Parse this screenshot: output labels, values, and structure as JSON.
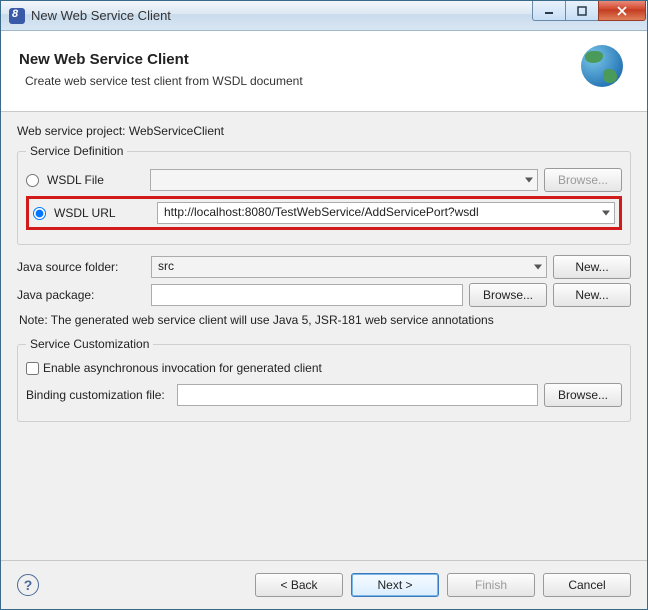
{
  "window": {
    "title": "New Web Service Client"
  },
  "banner": {
    "heading": "New Web Service Client",
    "subtitle": "Create web service test client from WSDL document"
  },
  "project": {
    "label": "Web service project:",
    "value": "WebServiceClient"
  },
  "service_definition": {
    "legend": "Service Definition",
    "wsdl_file": {
      "label": "WSDL File",
      "value": "",
      "browse": "Browse..."
    },
    "wsdl_url": {
      "label": "WSDL URL",
      "value": "http://localhost:8080/TestWebService/AddServicePort?wsdl",
      "selected": true
    }
  },
  "java_source": {
    "label": "Java source folder:",
    "value": "src",
    "new_btn": "New..."
  },
  "java_package": {
    "label": "Java package:",
    "value": "",
    "browse_btn": "Browse...",
    "new_btn": "New..."
  },
  "note": "Note: The generated web service client will use Java 5, JSR-181 web service annotations",
  "customization": {
    "legend": "Service Customization",
    "async_label": "Enable asynchronous invocation for generated client",
    "binding_label": "Binding customization file:",
    "binding_value": "",
    "browse_btn": "Browse..."
  },
  "footer": {
    "back": "< Back",
    "next": "Next >",
    "finish": "Finish",
    "cancel": "Cancel"
  }
}
